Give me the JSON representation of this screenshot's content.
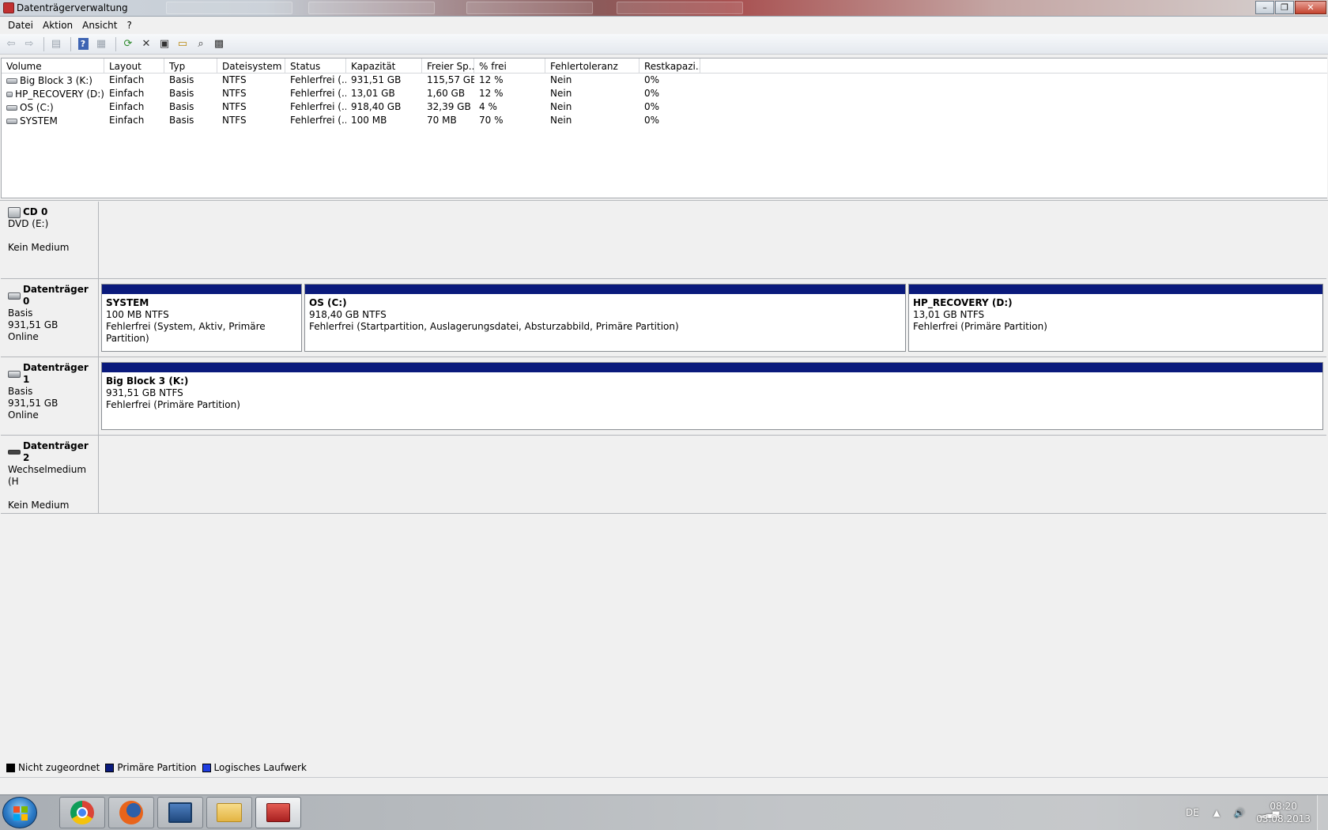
{
  "window": {
    "title": "Datenträgerverwaltung"
  },
  "menu": [
    "Datei",
    "Aktion",
    "Ansicht",
    "?"
  ],
  "toolbar": [
    {
      "name": "back-arrow-icon",
      "glyph": "⇦"
    },
    {
      "name": "forward-arrow-icon",
      "glyph": "⇨"
    },
    {
      "name": "console-tree-icon",
      "glyph": "▤"
    },
    {
      "name": "help-icon",
      "glyph": "?"
    },
    {
      "name": "properties-pane-icon",
      "glyph": "▦"
    },
    {
      "name": "refresh-icon",
      "glyph": "⟳"
    },
    {
      "name": "delete-icon",
      "glyph": "✕"
    },
    {
      "name": "properties-icon",
      "glyph": "▣"
    },
    {
      "name": "open-folder-icon",
      "glyph": "▭"
    },
    {
      "name": "search-icon",
      "glyph": "⌕"
    },
    {
      "name": "settings-icon",
      "glyph": "▩"
    }
  ],
  "volume_table": {
    "columns": [
      "Volume",
      "Layout",
      "Typ",
      "Dateisystem",
      "Status",
      "Kapazität",
      "Freier Sp...",
      "% frei",
      "Fehlertoleranz",
      "Restkapazi..."
    ],
    "rows": [
      [
        "Big Block 3 (K:)",
        "Einfach",
        "Basis",
        "NTFS",
        "Fehlerfrei (...",
        "931,51 GB",
        "115,57 GB",
        "12 %",
        "Nein",
        "0%"
      ],
      [
        "HP_RECOVERY (D:)",
        "Einfach",
        "Basis",
        "NTFS",
        "Fehlerfrei (...",
        "13,01 GB",
        "1,60 GB",
        "12 %",
        "Nein",
        "0%"
      ],
      [
        "OS (C:)",
        "Einfach",
        "Basis",
        "NTFS",
        "Fehlerfrei (...",
        "918,40 GB",
        "32,39 GB",
        "4 %",
        "Nein",
        "0%"
      ],
      [
        "SYSTEM",
        "Einfach",
        "Basis",
        "NTFS",
        "Fehlerfrei (...",
        "100 MB",
        "70 MB",
        "70 %",
        "Nein",
        "0%"
      ]
    ]
  },
  "disks": [
    {
      "name": "CD 0",
      "lines": [
        "DVD (E:)",
        "",
        "Kein Medium"
      ],
      "partitions": []
    },
    {
      "name": "Datenträger 0",
      "lines": [
        "Basis",
        "931,51 GB",
        "Online"
      ],
      "partitions": [
        {
          "name": "SYSTEM",
          "size": "100 MB NTFS",
          "status": "Fehlerfrei (System, Aktiv, Primäre Partition)"
        },
        {
          "name": "OS  (C:)",
          "size": "918,40 GB NTFS",
          "status": "Fehlerfrei (Startpartition, Auslagerungsdatei, Absturzabbild, Primäre Partition)"
        },
        {
          "name": "HP_RECOVERY  (D:)",
          "size": "13,01 GB NTFS",
          "status": "Fehlerfrei (Primäre Partition)"
        }
      ]
    },
    {
      "name": "Datenträger 1",
      "lines": [
        "Basis",
        "931,51 GB",
        "Online"
      ],
      "partitions": [
        {
          "name": "Big Block 3  (K:)",
          "size": "931,51 GB NTFS",
          "status": "Fehlerfrei (Primäre Partition)"
        }
      ]
    },
    {
      "name": "Datenträger 2",
      "lines": [
        "Wechselmedium (H",
        "",
        "Kein Medium"
      ],
      "partitions": []
    }
  ],
  "legend": [
    {
      "label": "Nicht zugeordnet",
      "color": "#000000"
    },
    {
      "label": "Primäre Partition",
      "color": "#0a1a7c"
    },
    {
      "label": "Logisches Laufwerk",
      "color": "#1f3de0"
    }
  ],
  "taskbar": {
    "apps": [
      "chrome-icon",
      "firefox-icon",
      "monitor-icon",
      "folder-icon",
      "toolbox-icon"
    ],
    "language": "DE",
    "time": "08:20",
    "date": "03.08.2013"
  }
}
